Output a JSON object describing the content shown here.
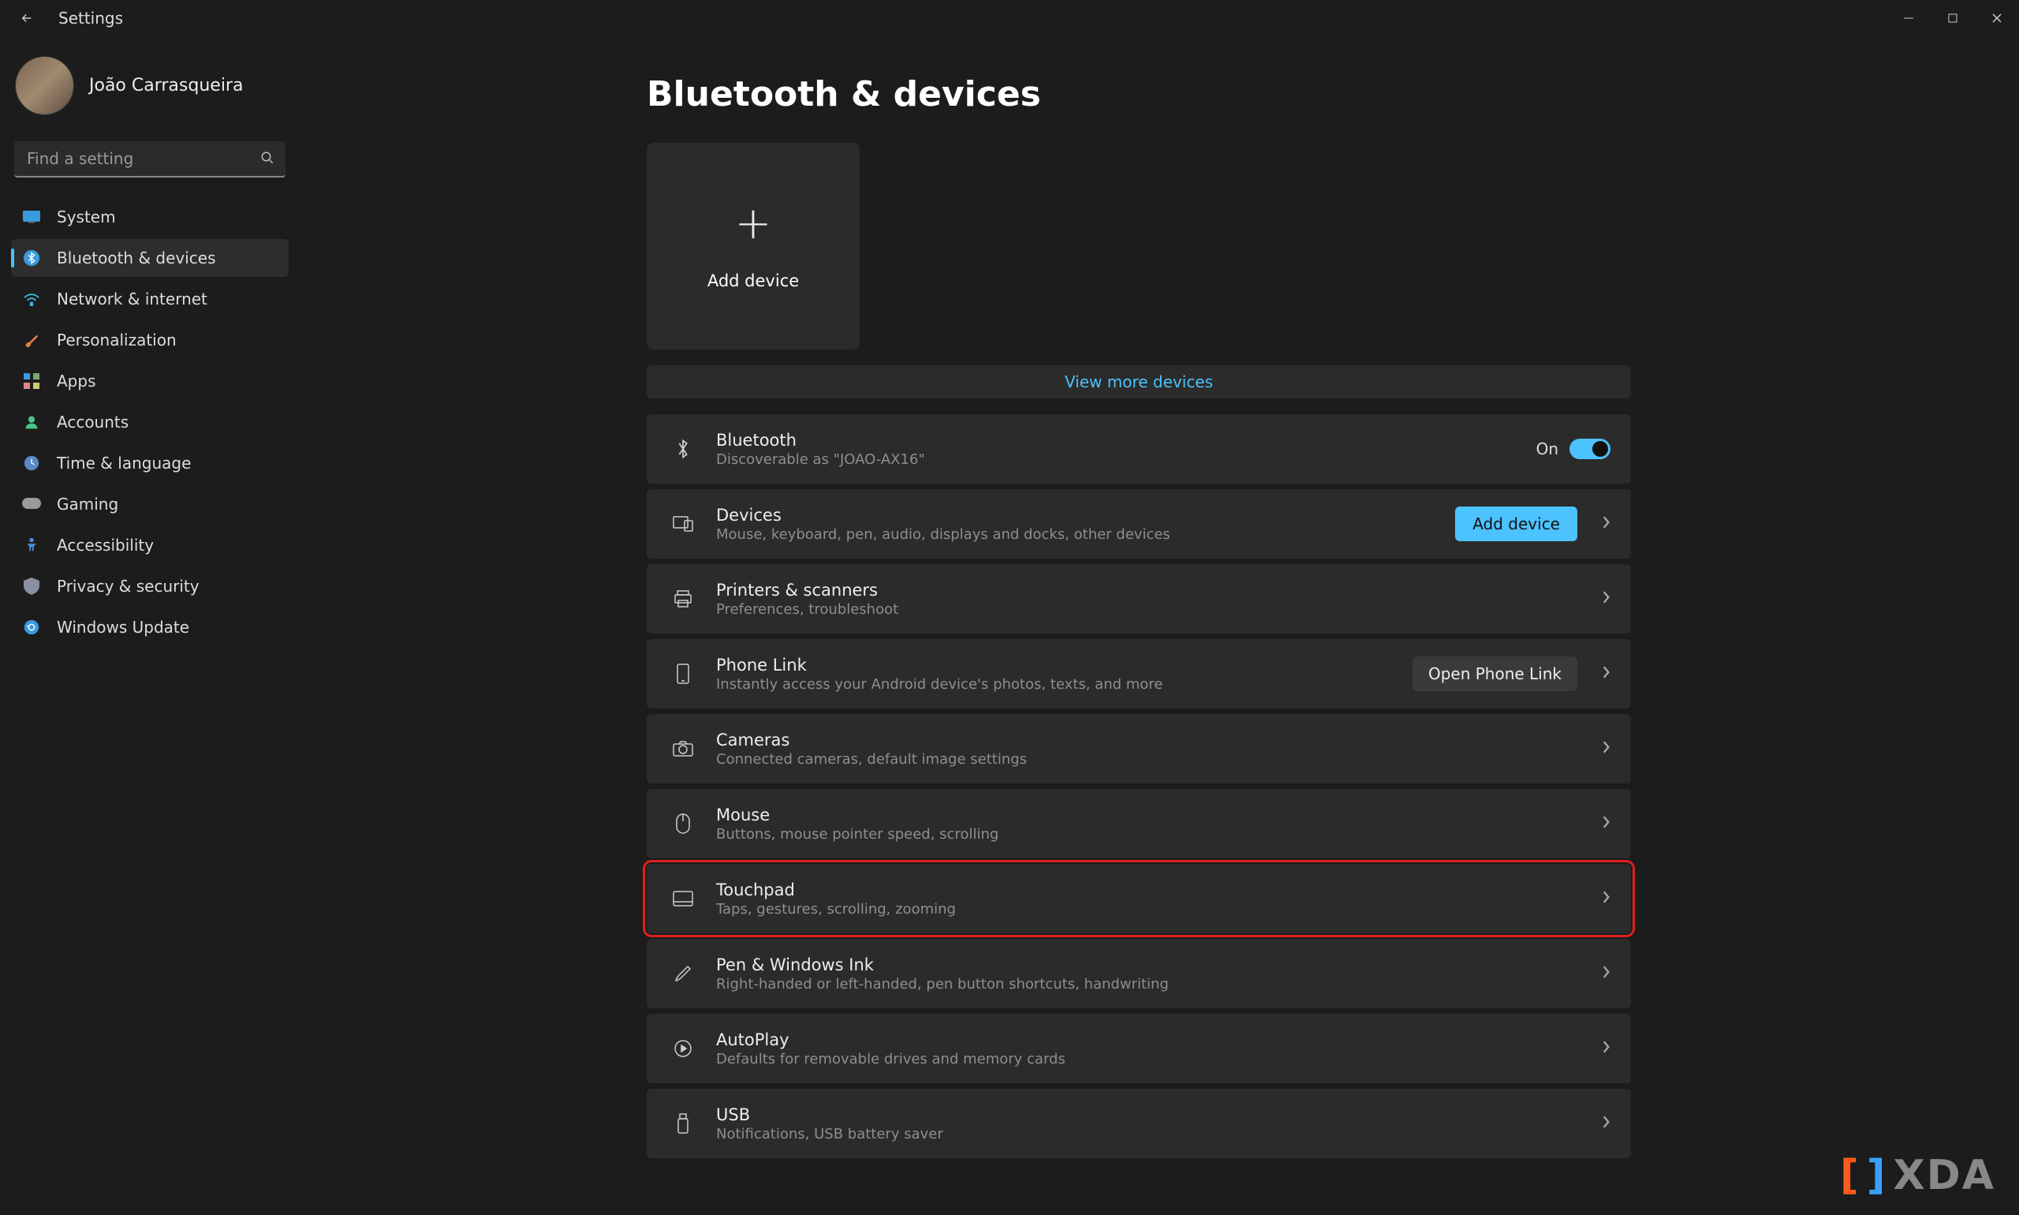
{
  "app_title": "Settings",
  "user_name": "João Carrasqueira",
  "search_placeholder": "Find a setting",
  "sidebar": [
    {
      "id": "system",
      "label": "System"
    },
    {
      "id": "bluetooth",
      "label": "Bluetooth & devices",
      "active": true
    },
    {
      "id": "network",
      "label": "Network & internet"
    },
    {
      "id": "personalization",
      "label": "Personalization"
    },
    {
      "id": "apps",
      "label": "Apps"
    },
    {
      "id": "accounts",
      "label": "Accounts"
    },
    {
      "id": "time",
      "label": "Time & language"
    },
    {
      "id": "gaming",
      "label": "Gaming"
    },
    {
      "id": "accessibility",
      "label": "Accessibility"
    },
    {
      "id": "privacy",
      "label": "Privacy & security"
    },
    {
      "id": "update",
      "label": "Windows Update"
    }
  ],
  "page_title": "Bluetooth & devices",
  "add_device_tile": "Add device",
  "view_more": "View more devices",
  "toggle_on_label": "On",
  "rows": {
    "bluetooth": {
      "title": "Bluetooth",
      "sub": "Discoverable as \"JOAO-AX16\""
    },
    "devices": {
      "title": "Devices",
      "sub": "Mouse, keyboard, pen, audio, displays and docks, other devices",
      "button": "Add device"
    },
    "printers": {
      "title": "Printers & scanners",
      "sub": "Preferences, troubleshoot"
    },
    "phone": {
      "title": "Phone Link",
      "sub": "Instantly access your Android device's photos, texts, and more",
      "button": "Open Phone Link"
    },
    "cameras": {
      "title": "Cameras",
      "sub": "Connected cameras, default image settings"
    },
    "mouse": {
      "title": "Mouse",
      "sub": "Buttons, mouse pointer speed, scrolling"
    },
    "touchpad": {
      "title": "Touchpad",
      "sub": "Taps, gestures, scrolling, zooming"
    },
    "pen": {
      "title": "Pen & Windows Ink",
      "sub": "Right-handed or left-handed, pen button shortcuts, handwriting"
    },
    "autoplay": {
      "title": "AutoPlay",
      "sub": "Defaults for removable drives and memory cards"
    },
    "usb": {
      "title": "USB",
      "sub": "Notifications, USB battery saver"
    }
  },
  "watermark": "XDA"
}
